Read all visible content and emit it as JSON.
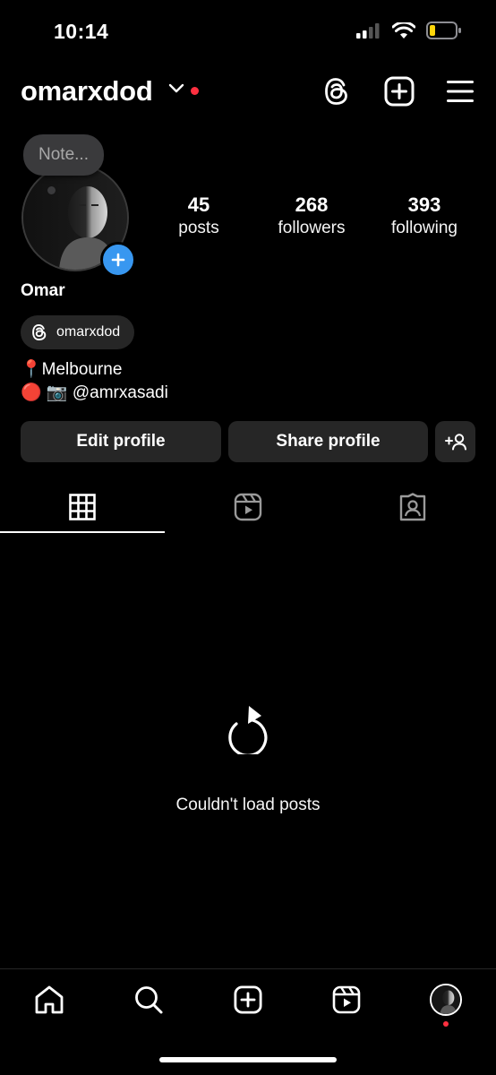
{
  "status_bar": {
    "time": "10:14",
    "battery_level": 0.2,
    "battery_color": "#ffd60a"
  },
  "header": {
    "username": "omarxdod",
    "icons": [
      "chevron-down-icon",
      "threads-icon",
      "create-post-icon",
      "menu-icon"
    ],
    "notification_dot_color": "#ff3040"
  },
  "profile": {
    "note_placeholder": "Note...",
    "display_name": "Omar",
    "threads_handle": "omarxdod",
    "stats": [
      {
        "value": "45",
        "label": "posts"
      },
      {
        "value": "268",
        "label": "followers"
      },
      {
        "value": "393",
        "label": "following"
      }
    ],
    "bio": {
      "line1": "📍Melbourne",
      "line2": "🔴 📷 @amrxasadi"
    }
  },
  "actions": {
    "edit_profile": "Edit profile",
    "share_profile": "Share profile",
    "discover_people_icon": "add-person-icon"
  },
  "tabs": [
    {
      "name": "grid",
      "icon": "grid-icon",
      "active": true
    },
    {
      "name": "reels",
      "icon": "reels-icon",
      "active": false
    },
    {
      "name": "tagged",
      "icon": "tagged-icon",
      "active": false
    }
  ],
  "empty_state": {
    "icon": "reload-icon",
    "message": "Couldn't load posts"
  },
  "bottom_nav": {
    "items": [
      "home-icon",
      "search-icon",
      "create-icon",
      "reels-icon",
      "profile-avatar"
    ]
  },
  "colors": {
    "background": "#000000",
    "button_bg": "#262626",
    "accent_blue": "#3897f0"
  }
}
